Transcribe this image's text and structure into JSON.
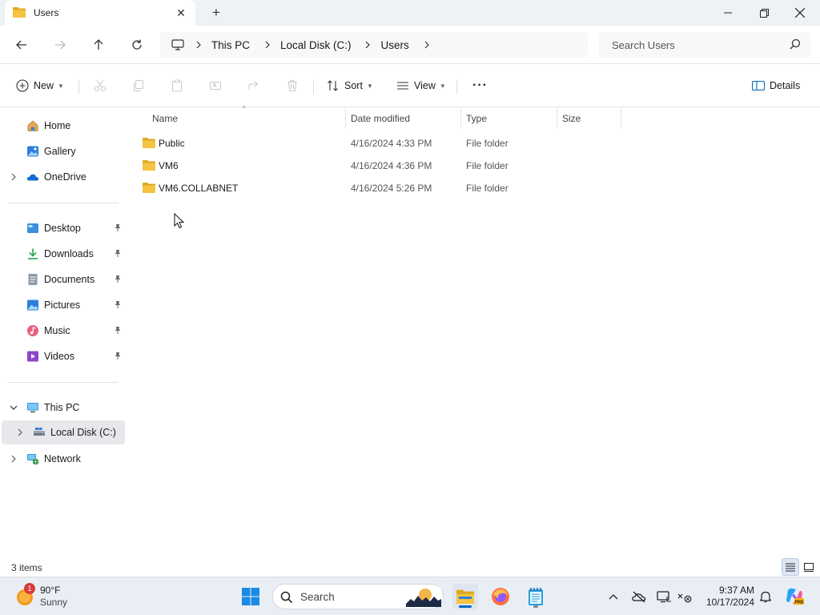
{
  "window": {
    "tab_title": "Users",
    "new_tab_glyph": "+",
    "close_tab_glyph": "✕"
  },
  "address": {
    "breadcrumbs": [
      "This PC",
      "Local Disk (C:)",
      "Users"
    ],
    "search_placeholder": "Search Users"
  },
  "commands": {
    "new_label": "New",
    "sort_label": "Sort",
    "view_label": "View",
    "more_label": "···",
    "details_label": "Details"
  },
  "sidebar": {
    "top_items": [
      {
        "label": "Home",
        "icon": "home-icon"
      },
      {
        "label": "Gallery",
        "icon": "gallery-icon"
      },
      {
        "label": "OneDrive",
        "icon": "onedrive-icon"
      }
    ],
    "quick_access": [
      {
        "label": "Desktop",
        "icon": "desktop-icon"
      },
      {
        "label": "Downloads",
        "icon": "downloads-icon"
      },
      {
        "label": "Documents",
        "icon": "documents-icon"
      },
      {
        "label": "Pictures",
        "icon": "pictures-icon"
      },
      {
        "label": "Music",
        "icon": "music-icon"
      },
      {
        "label": "Videos",
        "icon": "videos-icon"
      }
    ],
    "tree": [
      {
        "label": "This PC",
        "icon": "this-pc-icon"
      },
      {
        "label": "Local Disk (C:)",
        "icon": "local-disk-icon"
      },
      {
        "label": "Network",
        "icon": "network-icon"
      }
    ],
    "pin_glyph": "📌"
  },
  "columns": {
    "name": "Name",
    "date": "Date modified",
    "type": "Type",
    "size": "Size",
    "sort_glyph": "^"
  },
  "files": [
    {
      "name": "Public",
      "date": "4/16/2024 4:33 PM",
      "type": "File folder"
    },
    {
      "name": "VM6",
      "date": "4/16/2024 4:36 PM",
      "type": "File folder"
    },
    {
      "name": "VM6.COLLABNET",
      "date": "4/16/2024 5:26 PM",
      "type": "File folder"
    }
  ],
  "status": {
    "item_count": "3 items"
  },
  "taskbar": {
    "weather_temp": "90°F",
    "weather_cond": "Sunny",
    "weather_badge": "1",
    "search_label": "Search",
    "time": "9:37 AM",
    "date": "10/17/2024"
  },
  "colors": {
    "accent": "#0067c0",
    "folder": "#f5c342",
    "folder_dark": "#e0a820"
  }
}
